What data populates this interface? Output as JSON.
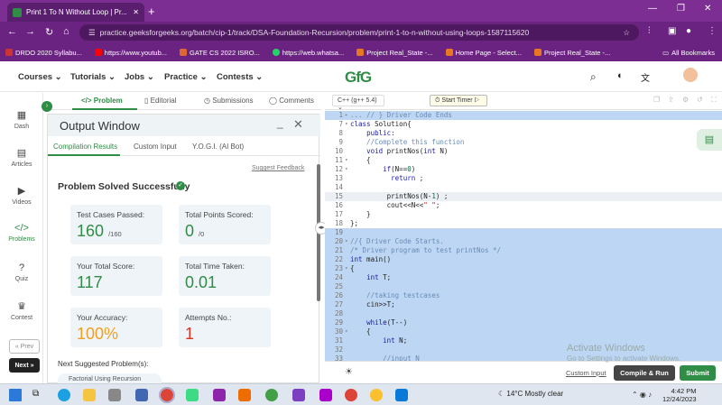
{
  "browser": {
    "tab_title": "Print 1 To N Without Loop | Pr...",
    "url": "practice.geeksforgeeks.org/batch/cip-1/track/DSA-Foundation-Recursion/problem/print-1-to-n-without-using-loops-1587115620",
    "bookmarks": [
      "DRDO 2020 Syllabu...",
      "https://www.youtub...",
      "GATE CS 2022 ISRO...",
      "https://web.whatsa...",
      "Project Real_State -...",
      "Home Page - Select...",
      "Project Real_State -..."
    ],
    "all_bookmarks": "All Bookmarks"
  },
  "site": {
    "logo": "GfG",
    "menu": [
      "Courses",
      "Tutorials",
      "Jobs",
      "Practice",
      "Contests"
    ]
  },
  "rail": {
    "items": [
      {
        "label": "Dash",
        "icon": "dashboard-icon"
      },
      {
        "label": "Articles",
        "icon": "article-icon"
      },
      {
        "label": "Videos",
        "icon": "video-icon"
      },
      {
        "label": "Problems",
        "icon": "code-icon"
      },
      {
        "label": "Quiz",
        "icon": "quiz-icon"
      },
      {
        "label": "Contest",
        "icon": "trophy-icon"
      }
    ],
    "prev": "« Prev",
    "next": "Next »"
  },
  "problem_tabs": [
    "</> Problem",
    "Editorial",
    "Submissions",
    "Comments"
  ],
  "output": {
    "title": "Output Window",
    "tabs": [
      "Compilation Results",
      "Custom Input",
      "Y.O.G.I. (AI Bot)"
    ],
    "suggest_feedback": "Suggest Feedback",
    "status": "Problem Solved Successfully",
    "cards": [
      {
        "label": "Test Cases Passed:",
        "value": "160",
        "suffix": "/160",
        "color": "#2f8d46"
      },
      {
        "label": "Total Points Scored:",
        "value": "0",
        "suffix": "/0",
        "color": "#2f8d46"
      },
      {
        "label": "Your Total Score:",
        "value": "117",
        "suffix": "",
        "color": "#2f8d46"
      },
      {
        "label": "Total Time Taken:",
        "value": "0.01",
        "suffix": "",
        "color": "#2f8d46"
      },
      {
        "label": "Your Accuracy:",
        "value": "100%",
        "suffix": "",
        "color": "#f0a020"
      },
      {
        "label": "Attempts No.:",
        "value": "1",
        "suffix": "",
        "color": "#e0301e"
      }
    ],
    "next_suggested": "Next Suggested Problem(s):",
    "suggested_item": "Factorial Using Recursion"
  },
  "editor": {
    "language": "C++ (g++ 5.4)",
    "timer": "Start Timer",
    "lines": [
      {
        "n": "1",
        "fold": "▸",
        "text": "... // } Driver Code Ends",
        "style": "sel"
      },
      {
        "n": "7",
        "fold": "▾",
        "text": "class Solution{",
        "style": ""
      },
      {
        "n": "8",
        "fold": "",
        "text": "    public:",
        "style": ""
      },
      {
        "n": "9",
        "fold": "",
        "text": "    //Complete this function",
        "style": ""
      },
      {
        "n": "10",
        "fold": "",
        "text": "    void printNos(int N)",
        "style": ""
      },
      {
        "n": "11",
        "fold": "▾",
        "text": "    {",
        "style": ""
      },
      {
        "n": "12",
        "fold": "▾",
        "text": "        if(N==0)",
        "style": ""
      },
      {
        "n": "13",
        "fold": "",
        "text": "          return ;",
        "style": ""
      },
      {
        "n": "14",
        "fold": "",
        "text": "",
        "style": ""
      },
      {
        "n": "15",
        "fold": "",
        "text": "         printNos(N-1) ;",
        "style": "curr"
      },
      {
        "n": "16",
        "fold": "",
        "text": "         cout<<N<<\" \";",
        "style": ""
      },
      {
        "n": "17",
        "fold": "",
        "text": "    }",
        "style": ""
      },
      {
        "n": "18",
        "fold": "",
        "text": "};",
        "style": ""
      },
      {
        "n": "19",
        "fold": "",
        "text": "",
        "style": "sel"
      },
      {
        "n": "20",
        "fold": "▾",
        "text": "//{ Driver Code Starts.",
        "style": "sel"
      },
      {
        "n": "21",
        "fold": "",
        "text": "/* Driver program to test printNos */",
        "style": "sel"
      },
      {
        "n": "22",
        "fold": "",
        "text": "int main()",
        "style": "sel"
      },
      {
        "n": "23",
        "fold": "▾",
        "text": "{",
        "style": "sel"
      },
      {
        "n": "24",
        "fold": "",
        "text": "    int T;",
        "style": "sel"
      },
      {
        "n": "25",
        "fold": "",
        "text": "",
        "style": "sel"
      },
      {
        "n": "26",
        "fold": "",
        "text": "    //taking testcases",
        "style": "sel"
      },
      {
        "n": "27",
        "fold": "",
        "text": "    cin>>T;",
        "style": "sel"
      },
      {
        "n": "28",
        "fold": "",
        "text": "",
        "style": "sel"
      },
      {
        "n": "29",
        "fold": "",
        "text": "    while(T--)",
        "style": "sel"
      },
      {
        "n": "30",
        "fold": "▾",
        "text": "    {",
        "style": "sel"
      },
      {
        "n": "31",
        "fold": "",
        "text": "        int N;",
        "style": "sel"
      },
      {
        "n": "32",
        "fold": "",
        "text": "",
        "style": "sel"
      },
      {
        "n": "33",
        "fold": "",
        "text": "        //input N",
        "style": "sel"
      }
    ],
    "custom_input": "Custom Input",
    "compile_run": "Compile & Run",
    "submit": "Submit"
  },
  "watermark": {
    "line1": "Activate Windows",
    "line2": "Go to Settings to activate Windows."
  },
  "taskbar": {
    "weather": "14°C  Mostly clear",
    "lang": "ENG IN",
    "time": "4:42 PM",
    "date": "12/24/2023"
  }
}
